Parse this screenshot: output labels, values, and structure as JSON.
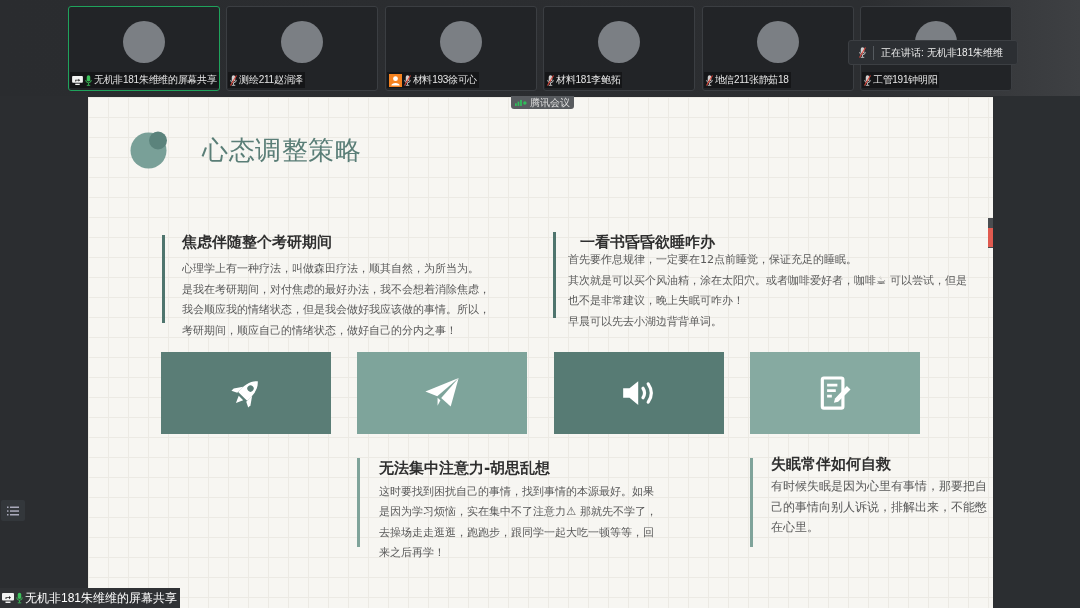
{
  "participants": [
    {
      "name": "无机非181朱维维的屏幕共享",
      "selected": true,
      "sharing": true,
      "host": false,
      "muted": false
    },
    {
      "name": "测绘211赵润泽",
      "selected": false,
      "sharing": false,
      "host": false,
      "muted": true
    },
    {
      "name": "材料193徐可心",
      "selected": false,
      "sharing": false,
      "host": true,
      "muted": true
    },
    {
      "name": "材料181李鲍拓",
      "selected": false,
      "sharing": false,
      "host": false,
      "muted": true
    },
    {
      "name": "地信211张静茹18",
      "selected": false,
      "sharing": false,
      "host": false,
      "muted": true
    },
    {
      "name": "工管191钟明阳",
      "selected": false,
      "sharing": false,
      "host": false,
      "muted": true
    }
  ],
  "speaking_toast": {
    "label": "正在讲话: 无机非181朱维维",
    "muted": true
  },
  "app_tag": {
    "label": "腾讯会议"
  },
  "slide": {
    "title": "心态调整策略",
    "cards": [
      {
        "heading": "焦虑伴随整个考研期间",
        "body": [
          "心理学上有一种疗法，叫做森田疗法，顺其自然，为所当为。",
          "是我在考研期间，对付焦虑的最好办法，我不会想着消除焦虑，我会顺应我的情绪状态，但是我会做好我应该做的事情。所以，考研期间，顺应自己的情绪状态，做好自己的分内之事！"
        ]
      },
      {
        "heading": "一看书昏昏欲睡咋办",
        "body": [
          "首先要作息规律，一定要在12点前睡觉，保证充足的睡眠。",
          "其次就是可以买个风油精，涂在太阳穴。或者咖啡爱好者，咖啡☕ 可以尝试，但是也不是非常建议，晚上失眠可咋办！",
          "早晨可以先去小湖边背背单词。"
        ]
      },
      {
        "heading": "无法集中注意力-胡思乱想",
        "body": [
          "这时要找到困扰自己的事情，找到事情的本源最好。如果是因为学习烦恼，实在集中不了注意力⚠ 那就先不学了，去操场走走逛逛，跑跑步，跟同学一起大吃一顿等等，回来之后再学！"
        ]
      },
      {
        "heading": "失眠常伴如何自救",
        "body": [
          "有时候失眠是因为心里有事情，那要把自己的事情向别人诉说，排解出来，不能憋在心里。"
        ]
      }
    ]
  },
  "share_bar": {
    "label": "无机非181朱维维的屏幕共享",
    "muted": false
  }
}
